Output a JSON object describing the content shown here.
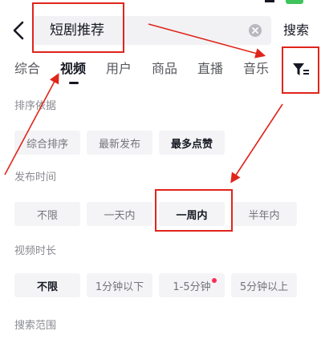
{
  "search": {
    "query": "短剧推荐",
    "submit_label": "搜索"
  },
  "tabs": [
    {
      "label": "综合",
      "active": false
    },
    {
      "label": "视频",
      "active": true
    },
    {
      "label": "用户",
      "active": false
    },
    {
      "label": "商品",
      "active": false
    },
    {
      "label": "直播",
      "active": false
    },
    {
      "label": "音乐",
      "active": false
    }
  ],
  "filters": {
    "sort": {
      "title": "排序依据",
      "options": [
        {
          "label": "综合排序",
          "selected": false
        },
        {
          "label": "最新发布",
          "selected": false
        },
        {
          "label": "最多点赞",
          "selected": true
        }
      ]
    },
    "publish_time": {
      "title": "发布时间",
      "options": [
        {
          "label": "不限",
          "selected": false
        },
        {
          "label": "一天内",
          "selected": false
        },
        {
          "label": "一周内",
          "selected": true
        },
        {
          "label": "半年内",
          "selected": false
        }
      ]
    },
    "duration": {
      "title": "视频时长",
      "options": [
        {
          "label": "不限",
          "selected": true
        },
        {
          "label": "1分钟以下",
          "selected": false
        },
        {
          "label": "1-5分钟",
          "selected": false,
          "has_dot": true
        },
        {
          "label": "5分钟以上",
          "selected": false
        }
      ]
    },
    "scope": {
      "title": "搜索范围"
    }
  },
  "colors": {
    "annotation": "#e0251b",
    "chip_bg": "#f4f4f6",
    "badge_dot": "#fe2c55"
  }
}
